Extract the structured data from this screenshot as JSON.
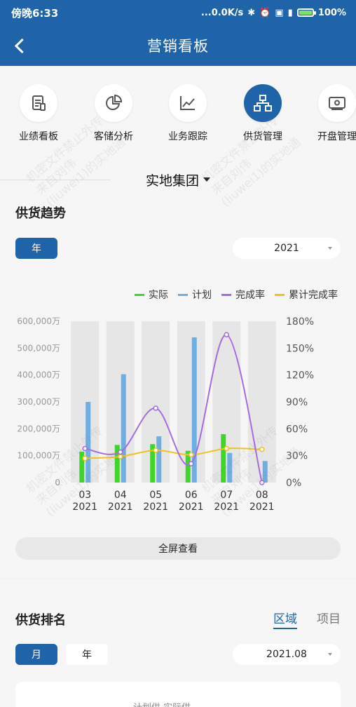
{
  "status_bar": {
    "time": "傍晚6:33",
    "network_speed": "...0.0K/s",
    "battery_percent": "100%",
    "battery_level": 1.0
  },
  "app_bar": {
    "title": "营销看板"
  },
  "nav": {
    "items": [
      {
        "label": "业绩看板",
        "icon": "report-icon",
        "active": false
      },
      {
        "label": "客储分析",
        "icon": "pie-chart-icon",
        "active": false
      },
      {
        "label": "业务跟踪",
        "icon": "line-chart-icon",
        "active": false
      },
      {
        "label": "供货管理",
        "icon": "hierarchy-icon",
        "active": true
      },
      {
        "label": "开盘管理",
        "icon": "money-icon",
        "active": false
      }
    ]
  },
  "company": {
    "name": "实地集团"
  },
  "supply_trend": {
    "title": "供货趋势",
    "period_button": "年",
    "year_select": "2021",
    "fullscreen_label": "全屏查看"
  },
  "chart_data": {
    "type": "bar",
    "categories": [
      "03\n2021",
      "04\n2021",
      "05\n2021",
      "06\n2021",
      "07\n2021",
      "08\n2021"
    ],
    "category_labels": [
      [
        "03",
        "2021"
      ],
      [
        "04",
        "2021"
      ],
      [
        "05",
        "2021"
      ],
      [
        "06",
        "2021"
      ],
      [
        "07",
        "2021"
      ],
      [
        "08",
        "2021"
      ]
    ],
    "series": [
      {
        "name": "实际",
        "type": "bar",
        "axis": "left",
        "color": "#3ed629",
        "values": [
          115000,
          140000,
          143000,
          118000,
          180000,
          0
        ]
      },
      {
        "name": "计划",
        "type": "bar",
        "axis": "left",
        "color": "#6eaee2",
        "values": [
          300000,
          403000,
          172000,
          540000,
          110000,
          80000
        ]
      },
      {
        "name": "完成率",
        "type": "line",
        "axis": "right",
        "color": "#a56be0",
        "values": [
          38,
          34,
          83,
          21,
          165,
          0
        ]
      },
      {
        "name": "累计完成率",
        "type": "line",
        "axis": "right",
        "color": "#f2c21d",
        "values": [
          27,
          29,
          36,
          31,
          38,
          37
        ]
      }
    ],
    "y_left": {
      "ylim": [
        0,
        600000
      ],
      "ticks": [
        "0",
        "100,000万",
        "200,000万",
        "300,000万",
        "400,000万",
        "500,000万",
        "600,000万"
      ]
    },
    "y_right": {
      "ylim": [
        0,
        180
      ],
      "ticks": [
        "0%",
        "30%",
        "60%",
        "90%",
        "120%",
        "150%",
        "180%"
      ]
    },
    "legend_position": "top-right",
    "grid": false
  },
  "supply_ranking": {
    "title": "供货排名",
    "tabs": [
      {
        "label": "区域",
        "active": true
      },
      {
        "label": "项目",
        "active": false
      }
    ],
    "period_buttons": [
      {
        "label": "月",
        "active": true
      },
      {
        "label": "年",
        "active": false
      }
    ],
    "month_select": "2021.08",
    "panel_legend": "计划供   实际供"
  },
  "watermark": {
    "lines": [
      "机密文件禁止外传",
      "来自刘伟",
      "(liuwei1)的实地通"
    ]
  }
}
